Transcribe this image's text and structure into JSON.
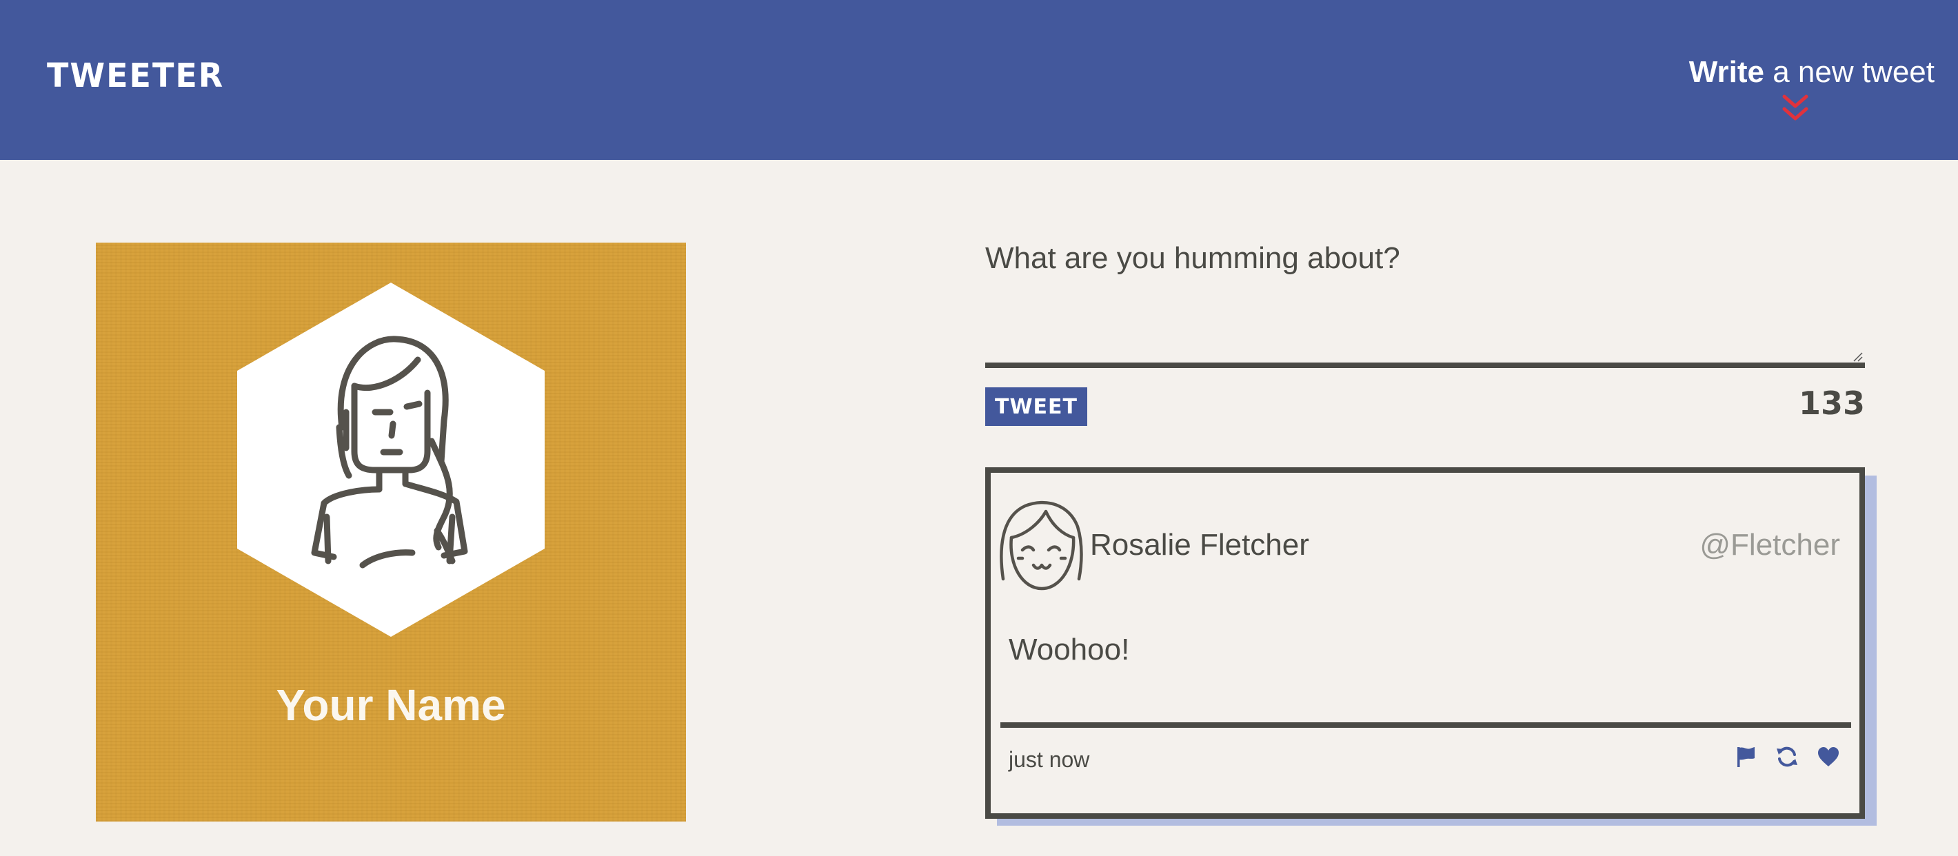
{
  "nav": {
    "brand": "TWEETER",
    "compose_bold": "Write",
    "compose_rest": " a new tweet",
    "compose_icon": "double-chevron-down-icon",
    "compose_icon_color": "#e0323c"
  },
  "profile": {
    "name": "Your Name",
    "avatar_icon": "woman-avatar-icon",
    "card_color": "#d7a038"
  },
  "composer": {
    "placeholder": "What are you humming about?",
    "value": "",
    "tweet_button_label": "TWEET",
    "counter": "133"
  },
  "tweets": [
    {
      "avatar_icon": "smiling-girl-avatar-icon",
      "author_name": "Rosalie Fletcher",
      "handle": "@Fletcher",
      "content": "Woohoo!",
      "timestamp": "just now",
      "actions": [
        "flag-icon",
        "retweet-icon",
        "heart-icon"
      ]
    }
  ],
  "colors": {
    "nav_background": "#43589c",
    "page_background": "#f4f1ed",
    "text": "#4a4a45",
    "accent_shadow": "#b2bde0",
    "handle_text": "#9a9a95"
  }
}
